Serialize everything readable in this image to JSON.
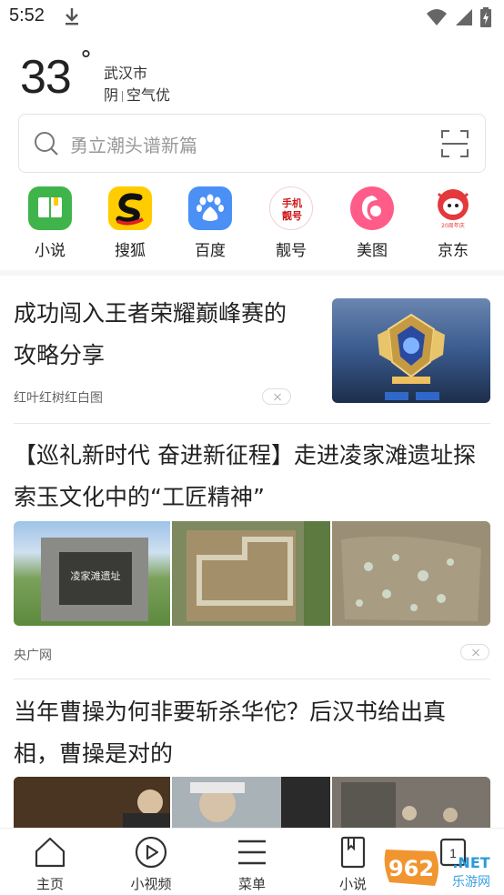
{
  "status_bar": {
    "time": "5:52"
  },
  "weather": {
    "temperature": "33",
    "degree": "°",
    "city": "武汉市",
    "condition": "阴",
    "air_quality": "空气优"
  },
  "search": {
    "placeholder": "勇立潮头谱新篇"
  },
  "shortcuts": [
    {
      "label": "小说",
      "icon": "book-icon",
      "color": "#3fb44a"
    },
    {
      "label": "搜狐",
      "icon": "sohu-icon",
      "color": "#ffcc00"
    },
    {
      "label": "百度",
      "icon": "baidu-paw-icon",
      "color": "#3388ff"
    },
    {
      "label": "靓号",
      "icon": "phone-number-icon",
      "color": "#e02020"
    },
    {
      "label": "美图",
      "icon": "meitu-icon",
      "color": "#ff5c8a"
    },
    {
      "label": "京东",
      "icon": "jd-icon",
      "color": "#e4393c",
      "badge": "20周年庆"
    }
  ],
  "news": [
    {
      "title": "成功闯入王者荣耀巅峰赛的攻略分享",
      "source": "红叶红树红白图"
    },
    {
      "title": "【巡礼新时代 奋进新征程】走进凌家滩遗址探索玉文化中的“工匠精神”",
      "source": "央广网",
      "stone_text": "凌家滩遗址"
    },
    {
      "title": "当年曹操为何非要斩杀华佗？后汉书给出真相，曹操是对的"
    }
  ],
  "tabbar": [
    {
      "label": "主页",
      "icon": "home-icon"
    },
    {
      "label": "小视频",
      "icon": "play-icon"
    },
    {
      "label": "菜单",
      "icon": "menu-icon"
    },
    {
      "label": "小说",
      "icon": "book-icon"
    },
    {
      "label": "1",
      "icon": "tabs-icon"
    }
  ],
  "watermark": {
    "number": "962",
    "suffix": ".NET",
    "subtitle": "乐游网"
  }
}
